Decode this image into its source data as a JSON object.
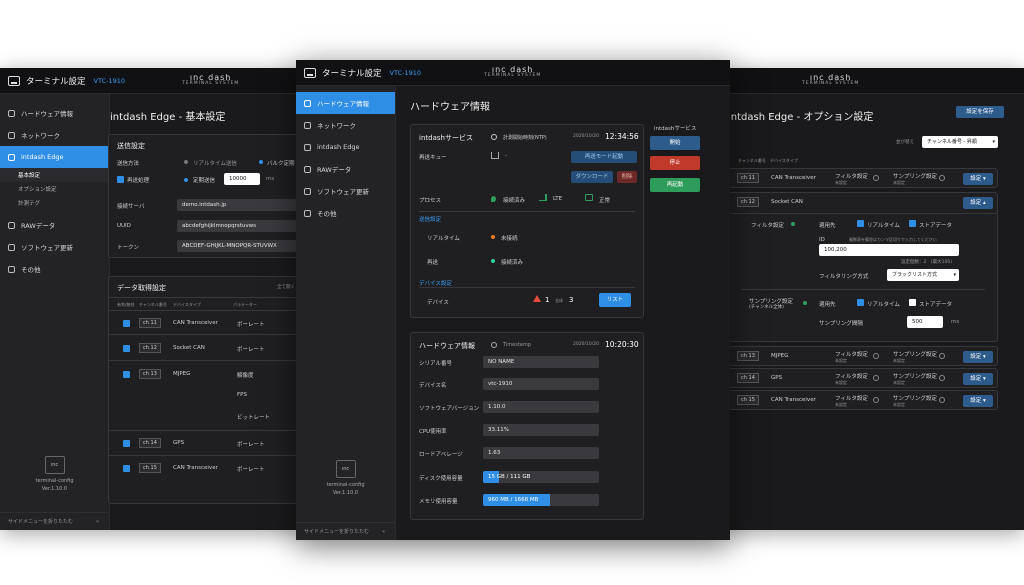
{
  "app": {
    "title": "ターミナル設定",
    "model": "VTC-1910",
    "brand_top": "ınc dash",
    "brand_bottom": "TERMINAL SYSTEM"
  },
  "sidebar": {
    "items": [
      {
        "label": "ハードウェア情報",
        "icon": "hardware-icon"
      },
      {
        "label": "ネットワーク",
        "icon": "network-icon"
      },
      {
        "label": "intdash Edge",
        "icon": "edge-icon"
      },
      {
        "label": "RAWデータ",
        "icon": "raw-data-icon"
      },
      {
        "label": "ソフトウェア更新",
        "icon": "update-icon"
      },
      {
        "label": "その他",
        "icon": "other-icon"
      }
    ],
    "sub_items": [
      "基本設定",
      "オプション設定",
      "計測テグ"
    ],
    "foot_name": "terminal-config",
    "foot_version": "Ver.1.10.0",
    "foot_logo": "ınc",
    "collapse_label": "サイドメニューを折りたたむ",
    "collapse_icon": "«"
  },
  "left": {
    "page_title": "intdash Edge - 基本設定",
    "send": {
      "title": "送信設定",
      "method_label": "送信方法",
      "realtime_label": "リアルタイム送信",
      "bulk_label": "バルク定期",
      "resend_label": "再送処理",
      "periodic_label": "定期送信",
      "periodic_value": "10000",
      "periodic_unit": "ms",
      "server_label": "接続サーバ",
      "server_value": "demo.intdash.jp",
      "uuid_label": "UUID",
      "uuid_value": "abcdefghijklmnopqrstuvws",
      "token_label": "トークン",
      "token_value": "ABCDEF-GHIJKL-MNOPQR-STUVWX"
    },
    "acq": {
      "title": "データ取得設定",
      "expand_label": "全て開く",
      "headers": [
        "有効/無効",
        "チャンネル番号",
        "デバイスタイプ",
        "パラメーター"
      ],
      "rows": [
        {
          "ch": "11",
          "device": "CAN Transceiver",
          "param": "ボーレート"
        },
        {
          "ch": "12",
          "device": "Socket CAN",
          "param": "ボーレート"
        },
        {
          "ch": "13",
          "device": "MJPEG",
          "param": "解像度",
          "param2": "FPS",
          "param3": "ビットレート"
        },
        {
          "ch": "14",
          "device": "GPS",
          "param": "ボーレート"
        },
        {
          "ch": "15",
          "device": "CAN Transceiver",
          "param": "ボーレート"
        }
      ],
      "ch_prefix": "ch"
    }
  },
  "center": {
    "page_title": "ハードウェア情報",
    "service": {
      "title": "intdashサービス",
      "ntp_label": "計測開始時刻(NTP)",
      "date": "2020/10/20",
      "time": "12:34:56",
      "queue_label": "再送キュー",
      "queue_value": "-",
      "resend_mode_btn": "再送モード起動",
      "download_btn": "ダウンロード",
      "delete_btn": "削除",
      "process_label": "プロセス",
      "connected_label": "接続済み",
      "lte_label": "LTE",
      "normal_label": "正常",
      "send_section": "送信設定",
      "realtime_label": "リアルタイム",
      "realtime_status": "未接続",
      "resend_label": "再送",
      "resend_status": "接続済み",
      "device_section": "デバイス設定",
      "device_label": "デバイス",
      "device_warn": "1",
      "device_total_label": "全体",
      "device_count": "3",
      "list_btn": "リスト"
    },
    "controls": {
      "title": "intdashサービス",
      "start": "開始",
      "stop": "停止",
      "restart": "再起動"
    },
    "hw": {
      "title": "ハードウェア情報",
      "timestamp_label": "Timestamp",
      "date": "2020/10/20",
      "time": "10:20:30",
      "rows": [
        {
          "label": "シリアル番号",
          "value": "NO NAME"
        },
        {
          "label": "デバイス名",
          "value": "vtc-1910"
        },
        {
          "label": "ソフトウェアバージョン",
          "value": "1.10.0"
        },
        {
          "label": "CPU使用率",
          "value": "33.11%"
        },
        {
          "label": "ロードアベレージ",
          "value": "1.63"
        }
      ],
      "disk_label": "ディスク使用容量",
      "disk_value": "15 GB / 111 GB",
      "disk_fraction": 0.135,
      "mem_label": "メモリ使用容量",
      "mem_value": "960 MB / 1668 MB",
      "mem_fraction": 0.575
    }
  },
  "right": {
    "page_title": "intdash Edge - オプション設定",
    "save_btn": "設定を保存",
    "sort_label": "並び替え",
    "sort_value": "チャンネル番号 - 昇順",
    "headers": [
      "チャンネル番号",
      "デバイスタイプ"
    ],
    "filter_label": "フィルタ設定",
    "sampling_label": "サンプリング設定",
    "unset_label": "未設定",
    "setting_btn": "設定",
    "rows": [
      {
        "ch": "11",
        "device": "CAN Transceiver"
      },
      {
        "ch": "12",
        "device": "Socket CAN"
      },
      {
        "ch": "13",
        "device": "MJPEG"
      },
      {
        "ch": "14",
        "device": "GPS"
      },
      {
        "ch": "15",
        "device": "CAN Transceiver"
      }
    ],
    "expanded": {
      "filter_title": "フィルタ設定",
      "apply_label": "適用先",
      "realtime_label": "リアルタイム",
      "store_label": "ストアデータ",
      "id_label": "ID",
      "id_hint": "複数表を備並はカンマ区切りで入力してください",
      "id_value": "100,200",
      "count_text": "設定個数：2　(最大100)",
      "filter_method_label": "フィルタリング方式",
      "filter_method_value": "ブラックリスト方式",
      "sampling_title": "サンプリング設定",
      "sampling_sub": "(チャンネル全体)",
      "interval_label": "サンプリング間隔",
      "interval_value": "500",
      "interval_unit": "ms"
    }
  }
}
